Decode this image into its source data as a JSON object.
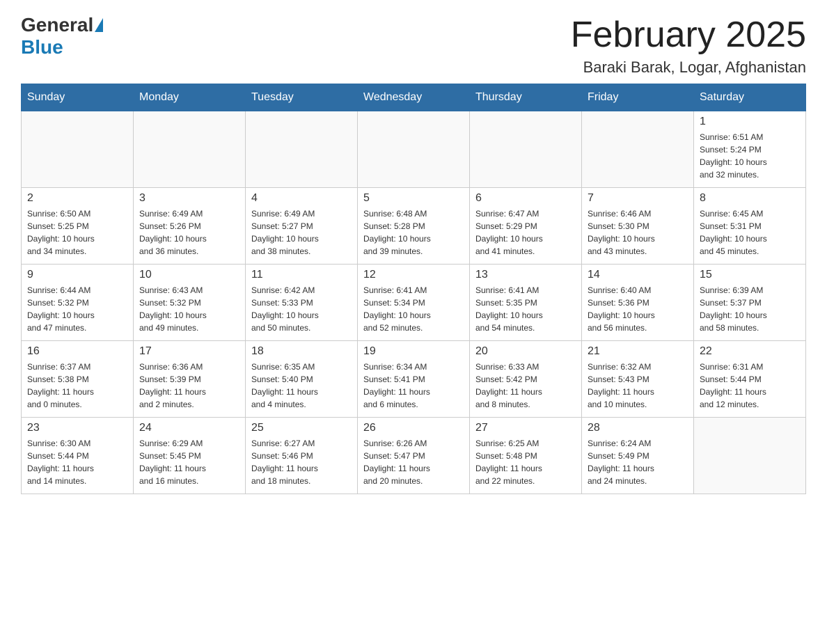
{
  "header": {
    "logo_general": "General",
    "logo_blue": "Blue",
    "month_title": "February 2025",
    "subtitle": "Baraki Barak, Logar, Afghanistan"
  },
  "weekdays": [
    "Sunday",
    "Monday",
    "Tuesday",
    "Wednesday",
    "Thursday",
    "Friday",
    "Saturday"
  ],
  "weeks": [
    [
      {
        "day": "",
        "info": ""
      },
      {
        "day": "",
        "info": ""
      },
      {
        "day": "",
        "info": ""
      },
      {
        "day": "",
        "info": ""
      },
      {
        "day": "",
        "info": ""
      },
      {
        "day": "",
        "info": ""
      },
      {
        "day": "1",
        "info": "Sunrise: 6:51 AM\nSunset: 5:24 PM\nDaylight: 10 hours\nand 32 minutes."
      }
    ],
    [
      {
        "day": "2",
        "info": "Sunrise: 6:50 AM\nSunset: 5:25 PM\nDaylight: 10 hours\nand 34 minutes."
      },
      {
        "day": "3",
        "info": "Sunrise: 6:49 AM\nSunset: 5:26 PM\nDaylight: 10 hours\nand 36 minutes."
      },
      {
        "day": "4",
        "info": "Sunrise: 6:49 AM\nSunset: 5:27 PM\nDaylight: 10 hours\nand 38 minutes."
      },
      {
        "day": "5",
        "info": "Sunrise: 6:48 AM\nSunset: 5:28 PM\nDaylight: 10 hours\nand 39 minutes."
      },
      {
        "day": "6",
        "info": "Sunrise: 6:47 AM\nSunset: 5:29 PM\nDaylight: 10 hours\nand 41 minutes."
      },
      {
        "day": "7",
        "info": "Sunrise: 6:46 AM\nSunset: 5:30 PM\nDaylight: 10 hours\nand 43 minutes."
      },
      {
        "day": "8",
        "info": "Sunrise: 6:45 AM\nSunset: 5:31 PM\nDaylight: 10 hours\nand 45 minutes."
      }
    ],
    [
      {
        "day": "9",
        "info": "Sunrise: 6:44 AM\nSunset: 5:32 PM\nDaylight: 10 hours\nand 47 minutes."
      },
      {
        "day": "10",
        "info": "Sunrise: 6:43 AM\nSunset: 5:32 PM\nDaylight: 10 hours\nand 49 minutes."
      },
      {
        "day": "11",
        "info": "Sunrise: 6:42 AM\nSunset: 5:33 PM\nDaylight: 10 hours\nand 50 minutes."
      },
      {
        "day": "12",
        "info": "Sunrise: 6:41 AM\nSunset: 5:34 PM\nDaylight: 10 hours\nand 52 minutes."
      },
      {
        "day": "13",
        "info": "Sunrise: 6:41 AM\nSunset: 5:35 PM\nDaylight: 10 hours\nand 54 minutes."
      },
      {
        "day": "14",
        "info": "Sunrise: 6:40 AM\nSunset: 5:36 PM\nDaylight: 10 hours\nand 56 minutes."
      },
      {
        "day": "15",
        "info": "Sunrise: 6:39 AM\nSunset: 5:37 PM\nDaylight: 10 hours\nand 58 minutes."
      }
    ],
    [
      {
        "day": "16",
        "info": "Sunrise: 6:37 AM\nSunset: 5:38 PM\nDaylight: 11 hours\nand 0 minutes."
      },
      {
        "day": "17",
        "info": "Sunrise: 6:36 AM\nSunset: 5:39 PM\nDaylight: 11 hours\nand 2 minutes."
      },
      {
        "day": "18",
        "info": "Sunrise: 6:35 AM\nSunset: 5:40 PM\nDaylight: 11 hours\nand 4 minutes."
      },
      {
        "day": "19",
        "info": "Sunrise: 6:34 AM\nSunset: 5:41 PM\nDaylight: 11 hours\nand 6 minutes."
      },
      {
        "day": "20",
        "info": "Sunrise: 6:33 AM\nSunset: 5:42 PM\nDaylight: 11 hours\nand 8 minutes."
      },
      {
        "day": "21",
        "info": "Sunrise: 6:32 AM\nSunset: 5:43 PM\nDaylight: 11 hours\nand 10 minutes."
      },
      {
        "day": "22",
        "info": "Sunrise: 6:31 AM\nSunset: 5:44 PM\nDaylight: 11 hours\nand 12 minutes."
      }
    ],
    [
      {
        "day": "23",
        "info": "Sunrise: 6:30 AM\nSunset: 5:44 PM\nDaylight: 11 hours\nand 14 minutes."
      },
      {
        "day": "24",
        "info": "Sunrise: 6:29 AM\nSunset: 5:45 PM\nDaylight: 11 hours\nand 16 minutes."
      },
      {
        "day": "25",
        "info": "Sunrise: 6:27 AM\nSunset: 5:46 PM\nDaylight: 11 hours\nand 18 minutes."
      },
      {
        "day": "26",
        "info": "Sunrise: 6:26 AM\nSunset: 5:47 PM\nDaylight: 11 hours\nand 20 minutes."
      },
      {
        "day": "27",
        "info": "Sunrise: 6:25 AM\nSunset: 5:48 PM\nDaylight: 11 hours\nand 22 minutes."
      },
      {
        "day": "28",
        "info": "Sunrise: 6:24 AM\nSunset: 5:49 PM\nDaylight: 11 hours\nand 24 minutes."
      },
      {
        "day": "",
        "info": ""
      }
    ]
  ]
}
